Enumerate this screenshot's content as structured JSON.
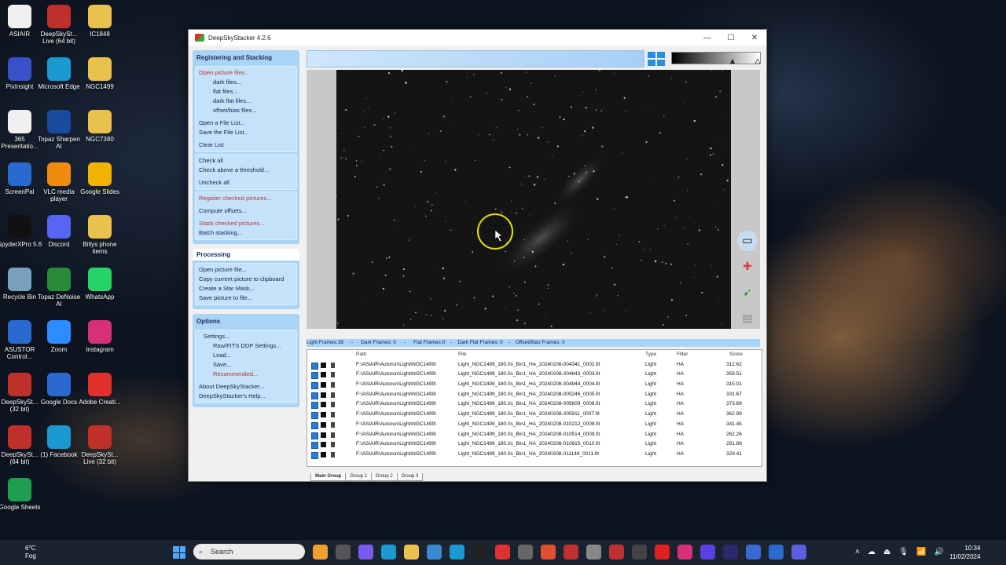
{
  "desktop_icons": [
    {
      "label": "ASIAIR",
      "color": "#f0f0f0"
    },
    {
      "label": "DeepSkySt... Live (64 bit)",
      "color": "#c0302a"
    },
    {
      "label": "IC1848",
      "color": "#e8c24a"
    },
    {
      "label": "PixInsight",
      "color": "#3a50c8"
    },
    {
      "label": "Microsoft Edge",
      "color": "#1a9ad0"
    },
    {
      "label": "NGC1499",
      "color": "#e8c24a"
    },
    {
      "label": "365 Presentatio...",
      "color": "#f0f0f0"
    },
    {
      "label": "Topaz Sharpen AI",
      "color": "#1a4aa0"
    },
    {
      "label": "NGC7380",
      "color": "#e8c24a"
    },
    {
      "label": "ScreenPal",
      "color": "#2a6ad0"
    },
    {
      "label": "VLC media player",
      "color": "#f08a10"
    },
    {
      "label": "Google Slides",
      "color": "#f0b400"
    },
    {
      "label": "SpyderXPro 5.6",
      "color": "#111111"
    },
    {
      "label": "Discord",
      "color": "#5865f2"
    },
    {
      "label": "Billys phone items",
      "color": "#e8c24a"
    },
    {
      "label": "Recycle Bin",
      "color": "#7aa0c0"
    },
    {
      "label": "Topaz DeNoise AI",
      "color": "#2a8a3a"
    },
    {
      "label": "WhatsApp",
      "color": "#25d366"
    },
    {
      "label": "ASUSTOR Control...",
      "color": "#2a6ad0"
    },
    {
      "label": "Zoom",
      "color": "#2d8cff"
    },
    {
      "label": "Instagram",
      "color": "#d6307a"
    },
    {
      "label": "DeepSkySt... (32 bit)",
      "color": "#c0302a"
    },
    {
      "label": "Google Docs",
      "color": "#2a6ad0"
    },
    {
      "label": "Adobe Creati...",
      "color": "#e0302a"
    },
    {
      "label": "DeepSkySt... (64 bit)",
      "color": "#c0302a"
    },
    {
      "label": "(1) Facebook",
      "color": "#1a9ad0"
    },
    {
      "label": "DeepSkySt... Live (32 bit)",
      "color": "#c0302a"
    },
    {
      "label": "Google Sheets",
      "color": "#1e9e50"
    }
  ],
  "window": {
    "title": "DeepSkyStacker 4.2.6",
    "minimize": "—",
    "maximize": "☐",
    "close": "✕"
  },
  "registering": {
    "header": "Registering and Stacking",
    "open_picture_files": "Open picture files...",
    "dark_files": "dark files...",
    "flat_files": "flat files...",
    "dark_flat_files": "dark flat files...",
    "offset_bias_files": "offset/bias files...",
    "open_file_list": "Open a File List...",
    "save_file_list": "Save the File List...",
    "clear_list": "Clear List",
    "check_all": "Check all",
    "check_above_threshold": "Check above a threshold...",
    "uncheck_all": "Uncheck all",
    "register_checked": "Register checked pictures...",
    "compute_offsets": "Compute offsets...",
    "stack_checked": "Stack checked pictures...",
    "batch_stacking": "Batch stacking..."
  },
  "processing": {
    "header": "Processing",
    "open_picture_file": "Open picture file...",
    "copy_to_clipboard": "Copy current picture to clipboard",
    "create_star_mask": "Create a Star Mask...",
    "save_picture": "Save picture to file..."
  },
  "options": {
    "header": "Options",
    "settings": "Settings...",
    "raw_fits": "Raw/FITS DDP Settings...",
    "load": "Load...",
    "save": "Save...",
    "recommended": "Recommended...",
    "about": "About DeepSkyStacker...",
    "help": "DeepSkyStacker's Help..."
  },
  "status": {
    "light": "Light Frames:38",
    "dark": "Dark Frames: 0",
    "flat": "Flat Frames:0",
    "dark_flat": "Dark Flat Frames: 0",
    "offset": "Offset/Bias Frames: 0",
    "sep": "-"
  },
  "file_list": {
    "columns": {
      "path": "Path",
      "file": "File",
      "type": "Type",
      "filter": "Filter",
      "score": "Score"
    },
    "rows": [
      {
        "path": "F:\\ASIAIR\\Autorun\\Light\\NGC1499\\",
        "file": "Light_NGC1499_180.0s_Bin1_HA_20240208-004341_0002.fit",
        "type": "Light",
        "filter": "HA",
        "score": "312.62"
      },
      {
        "path": "F:\\ASIAIR\\Autorun\\Light\\NGC1499\\",
        "file": "Light_NGC1499_180.0s_Bin1_HA_20240208-004643_0003.fit",
        "type": "Light",
        "filter": "HA",
        "score": "359.51"
      },
      {
        "path": "F:\\ASIAIR\\Autorun\\Light\\NGC1499\\",
        "file": "Light_NGC1499_180.0s_Bin1_HA_20240208-004944_0004.fit",
        "type": "Light",
        "filter": "HA",
        "score": "315.01"
      },
      {
        "path": "F:\\ASIAIR\\Autorun\\Light\\NGC1499\\",
        "file": "Light_NGC1499_180.0s_Bin1_HA_20240208-005246_0005.fit",
        "type": "Light",
        "filter": "HA",
        "score": "331.67"
      },
      {
        "path": "F:\\ASIAIR\\Autorun\\Light\\NGC1499\\",
        "file": "Light_NGC1499_180.0s_Bin1_HA_20240208-005609_0006.fit",
        "type": "Light",
        "filter": "HA",
        "score": "373.69"
      },
      {
        "path": "F:\\ASIAIR\\Autorun\\Light\\NGC1499\\",
        "file": "Light_NGC1499_180.0s_Bin1_HA_20240208-005911_0007.fit",
        "type": "Light",
        "filter": "HA",
        "score": "362.99"
      },
      {
        "path": "F:\\ASIAIR\\Autorun\\Light\\NGC1499\\",
        "file": "Light_NGC1499_180.0s_Bin1_HA_20240208-010212_0008.fit",
        "type": "Light",
        "filter": "HA",
        "score": "341.45"
      },
      {
        "path": "F:\\ASIAIR\\Autorun\\Light\\NGC1499\\",
        "file": "Light_NGC1499_180.0s_Bin1_HA_20240208-010514_0009.fit",
        "type": "Light",
        "filter": "HA",
        "score": "262.26"
      },
      {
        "path": "F:\\ASIAIR\\Autorun\\Light\\NGC1499\\",
        "file": "Light_NGC1499_180.0s_Bin1_HA_20240208-010815_0010.fit",
        "type": "Light",
        "filter": "HA",
        "score": "291.89"
      },
      {
        "path": "F:\\ASIAIR\\Autorun\\Light\\NGC1499\\",
        "file": "Light_NGC1499_180.0s_Bin1_HA_20240208-011148_0011.fit",
        "type": "Light",
        "filter": "HA",
        "score": "329.41"
      }
    ]
  },
  "tabs": [
    "Main Group",
    "Group 1",
    "Group 2",
    "Group 3"
  ],
  "taskbar": {
    "temp": "6°C",
    "weather": "Fog",
    "search_placeholder": "Search",
    "time": "10:34",
    "date": "11/02/2024"
  }
}
